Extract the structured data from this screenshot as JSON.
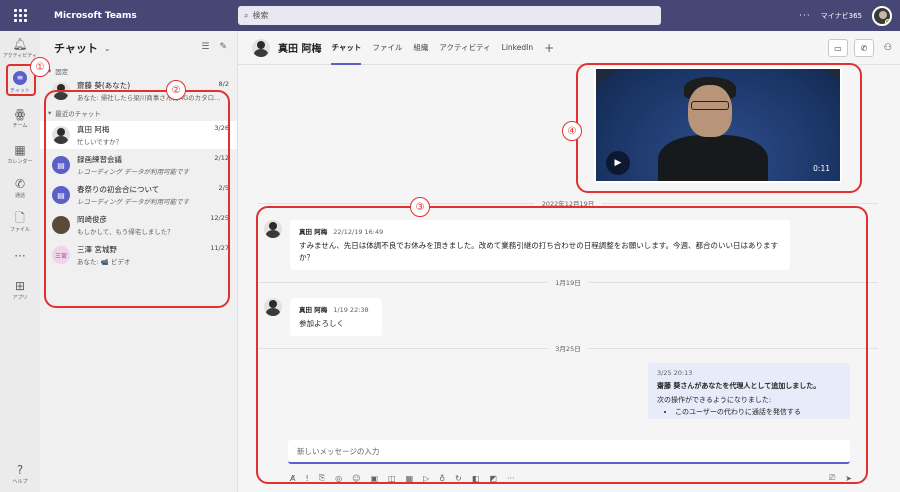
{
  "topbar": {
    "app_title": "Microsoft Teams",
    "search_placeholder": "検索",
    "more": "···",
    "user_name": "マイナビ365"
  },
  "rail": {
    "items": [
      {
        "label": "アクティビティ",
        "icon": "bell-icon"
      },
      {
        "label": "チャット",
        "icon": "chat-icon"
      },
      {
        "label": "チーム",
        "icon": "teams-icon"
      },
      {
        "label": "カレンダー",
        "icon": "calendar-icon"
      },
      {
        "label": "通話",
        "icon": "phone-icon"
      },
      {
        "label": "ファイル",
        "icon": "file-icon"
      },
      {
        "label": "···",
        "icon": "more-icon"
      },
      {
        "label": "アプリ",
        "icon": "apps-icon"
      },
      {
        "label": "ヘルプ",
        "icon": "help-icon"
      }
    ]
  },
  "chat_list": {
    "title": "チャット",
    "pinned_label": "固定",
    "recent_label": "最近のチャット",
    "pinned": [
      {
        "name": "齋藤 葵(あなた)",
        "date": "8/2",
        "preview": "あなた: 帰社したら梁川商事さんにAGのカタロ…"
      }
    ],
    "recent": [
      {
        "name": "真田 阿梅",
        "date": "3/26",
        "preview": "忙しいですか？",
        "italic": false
      },
      {
        "name": "録画練習会議",
        "date": "2/12",
        "preview": "レコーディング データが利用可能です",
        "italic": true
      },
      {
        "name": "春祭りの初会合について",
        "date": "2/5",
        "preview": "レコーディング データが利用可能です",
        "italic": true
      },
      {
        "name": "岡崎俊彦",
        "date": "12/25",
        "preview": "もしかして、もう帰宅しました？",
        "italic": false
      },
      {
        "name": "三澤 宮城野",
        "date": "11/27",
        "preview": "あなた: 📹 ビデオ",
        "italic": false,
        "initials": "三宮"
      }
    ]
  },
  "conversation": {
    "contact_name": "真田 阿梅",
    "tabs": [
      "チャット",
      "ファイル",
      "組織",
      "アクティビティ",
      "LinkedIn"
    ],
    "tab_plus": "+",
    "video_duration": "0:11",
    "date_dividers": [
      "2022年12月19日",
      "1月19日",
      "3月25日"
    ],
    "messages": [
      {
        "sender": "真田 阿梅",
        "time": "22/12/19 16:49",
        "text": "すみません、先日は体調不良でお休みを頂きました。改めて業務引継の打ち合わせの日程調整をお願いします。今週、都合のいい日はありますか？"
      },
      {
        "sender": "真田 阿梅",
        "time": "1/19 22:38",
        "text": "参加よろしく"
      }
    ],
    "system_message": {
      "time": "3/25 20:13",
      "headline": "齋藤 葵さんがあなたを代理人として追加しました。",
      "intro": "次の操作ができるようになりました:",
      "bullet": "このユーザーの代わりに通話を発信する"
    },
    "composer_placeholder": "新しいメッセージの入力"
  },
  "annotations": [
    "①",
    "②",
    "③",
    "④"
  ],
  "colors": {
    "brand": "#464775",
    "accent": "#5b5fc7",
    "annotation": "#e03030"
  }
}
